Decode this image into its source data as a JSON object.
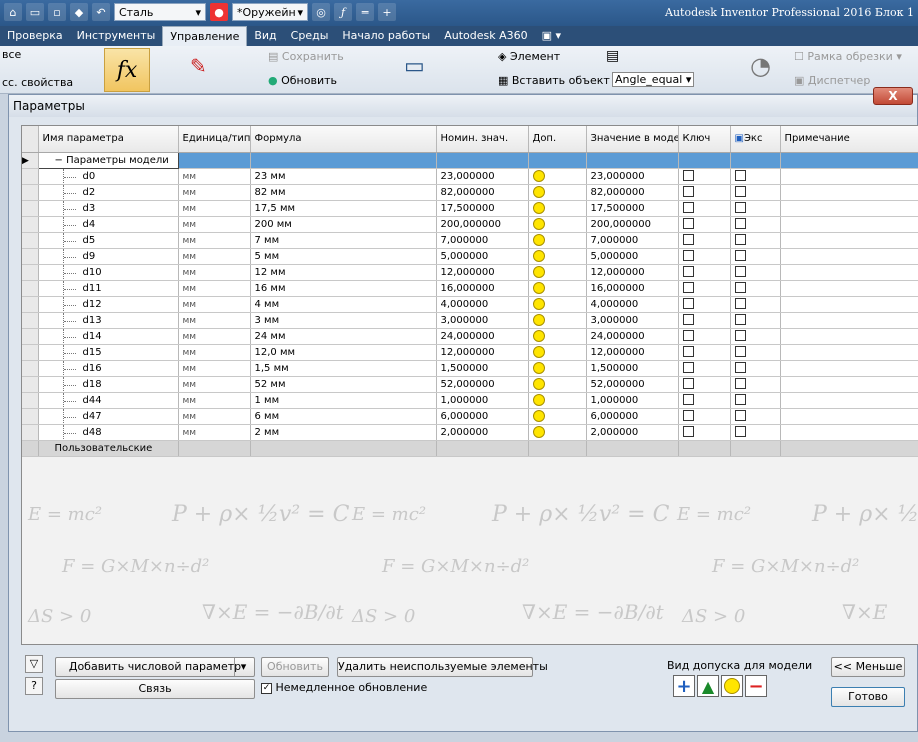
{
  "app": {
    "title": "Autodesk Inventor Professional 2016   Блок 1",
    "material_combo": "Сталь",
    "appearance_combo": "*Оружейн"
  },
  "tabs": [
    "Проверка",
    "Инструменты",
    "Управление",
    "Вид",
    "Среды",
    "Начало работы",
    "Autodesk A360"
  ],
  "active_tab": "Управление",
  "ribbon": {
    "left_top": "все",
    "left_bottom": "сс. свойства",
    "save": "Сохранить",
    "update": "Обновить",
    "element": "Элемент",
    "insert_object": "Вставить объект",
    "angle_combo": "Angle_equal",
    "crop_frame": "Рамка обрезки",
    "dispatcher": "Диспетчер"
  },
  "dialog": {
    "title": "Параметры",
    "close": "X"
  },
  "table": {
    "headers": {
      "name": "Имя параметра",
      "unit": "Единица/тип",
      "formula": "Формула",
      "nominal": "Номин. знач.",
      "tol": "Доп.",
      "model_value": "Значение в модел",
      "key": "Ключ",
      "export": "Экс",
      "comment": "Примечание"
    },
    "group_label": "Параметры модели",
    "user_label": "Пользовательские",
    "rows": [
      {
        "name": "d0",
        "unit": "мм",
        "formula": "23 мм",
        "nominal": "23,000000",
        "model": "23,000000"
      },
      {
        "name": "d2",
        "unit": "мм",
        "formula": "82 мм",
        "nominal": "82,000000",
        "model": "82,000000"
      },
      {
        "name": "d3",
        "unit": "мм",
        "formula": "17,5 мм",
        "nominal": "17,500000",
        "model": "17,500000"
      },
      {
        "name": "d4",
        "unit": "мм",
        "formula": "200 мм",
        "nominal": "200,000000",
        "model": "200,000000"
      },
      {
        "name": "d5",
        "unit": "мм",
        "formula": "7 мм",
        "nominal": "7,000000",
        "model": "7,000000"
      },
      {
        "name": "d9",
        "unit": "мм",
        "formula": "5 мм",
        "nominal": "5,000000",
        "model": "5,000000"
      },
      {
        "name": "d10",
        "unit": "мм",
        "formula": "12 мм",
        "nominal": "12,000000",
        "model": "12,000000"
      },
      {
        "name": "d11",
        "unit": "мм",
        "formula": "16 мм",
        "nominal": "16,000000",
        "model": "16,000000"
      },
      {
        "name": "d12",
        "unit": "мм",
        "formula": "4 мм",
        "nominal": "4,000000",
        "model": "4,000000"
      },
      {
        "name": "d13",
        "unit": "мм",
        "formula": "3 мм",
        "nominal": "3,000000",
        "model": "3,000000"
      },
      {
        "name": "d14",
        "unit": "мм",
        "formula": "24 мм",
        "nominal": "24,000000",
        "model": "24,000000"
      },
      {
        "name": "d15",
        "unit": "мм",
        "formula": "12,0 мм",
        "nominal": "12,000000",
        "model": "12,000000"
      },
      {
        "name": "d16",
        "unit": "мм",
        "formula": "1,5 мм",
        "nominal": "1,500000",
        "model": "1,500000"
      },
      {
        "name": "d18",
        "unit": "мм",
        "formula": "52 мм",
        "nominal": "52,000000",
        "model": "52,000000"
      },
      {
        "name": "d44",
        "unit": "мм",
        "formula": "1 мм",
        "nominal": "1,000000",
        "model": "1,000000"
      },
      {
        "name": "d47",
        "unit": "мм",
        "formula": "6 мм",
        "nominal": "6,000000",
        "model": "6,000000"
      },
      {
        "name": "d48",
        "unit": "мм",
        "formula": "2 мм",
        "nominal": "2,000000",
        "model": "2,000000"
      }
    ]
  },
  "bottom": {
    "add_numeric": "Добавить числовой параметр",
    "update": "Обновить",
    "remove_unused": "Удалить неиспользуемые элементы",
    "link": "Связь",
    "immediate_update": "Немедленное обновление",
    "tolerance_label": "Вид допуска для модели",
    "less": "<< Меньше",
    "done": "Готово"
  },
  "colors": {
    "selected_row": "#5b9bd5",
    "tol_dot": "#ffe500",
    "tol_plus": "#1f5fbf",
    "tol_up": "#1a8a2a",
    "tol_minus": "#d22"
  }
}
